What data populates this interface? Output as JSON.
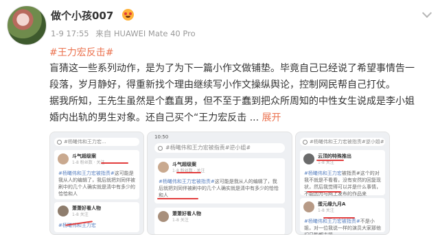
{
  "post": {
    "username": "做个小孩007",
    "timestamp": "1-9 17:55",
    "source": "来自 HUAWEI Mate 40 Pro",
    "hashtag": "#王力宏反击#",
    "lines": [
      "盲猜这一些系列动作，是为了为下一篇小作文做铺垫。毕竟自己已经说了希望事情告一",
      "段落，岁月静好，得重新找个理由继续写小作文操纵舆论，控制网民帮自己打仗。",
      "据我所知，王先生虽然是个蠢直男，但不至于蠢到把众所周知的中性女生说成是李小姐",
      "婚内出轨的男生对象。还自己买个“王力宏反击"
    ],
    "ellipsis": " ... ",
    "expand_label": "展开"
  },
  "images": [
    {
      "search_text": "#杨曦伟和王力宏...",
      "cards": [
        {
          "name": "斗气超级案",
          "sub": "1-8 粉丝数 · 关注",
          "text_pre": "",
          "text_tag": "#杨曦伟和王力宏被指责#",
          "text_post": "这可能是我从人的编辑了，我后就把刘同伴被刷中的几个人确实就是清中有多少的恰恰和人"
        },
        {
          "name": "萧萧好看人物",
          "sub": "1-8 关注",
          "text_pre": "",
          "text_tag": "#杨曦伟和王力宏",
          "text_post": ""
        }
      ]
    },
    {
      "status": "10:50",
      "search_text": "#杨曦伟和王力宏被指责#逆小姐#",
      "cards": [
        {
          "name": "斗气超级案",
          "sub": "1-8 粉丝数 · 关注",
          "text_pre": "",
          "text_tag": "#杨曦伟和王力宏被指责#",
          "text_post": "这可能是我从人的编辑了，我后就把刘同伴被刷中的几个人确实就是清中有多少的恰恰和人"
        },
        {
          "name": "萧萧好看人物",
          "sub": "1-8 关注",
          "text_pre": "",
          "text_tag": "",
          "text_post": ""
        }
      ]
    },
    {
      "search_text": "#杨曦伟和王力宏被指责#逆小姐#",
      "cards": [
        {
          "name": "云顶的特殊推出",
          "sub": "1-8 关注",
          "text_pre": "",
          "text_tag": "#杨曦伟和王力宏",
          "text_post": "被指责#这个的对我不就是不看看，没有安然的回复现状，然后我觉得可以并是什么事情，不能因为与网上发布的作品来"
        },
        {
          "name": "蛋元缘九月A",
          "sub": "1-8 关注",
          "text_pre": "",
          "text_tag": "#杨曦伟和王力宏被指责#",
          "text_post": "不是小姐，对一位我说一样的演员大家那他们只能都支援"
        }
      ]
    }
  ]
}
